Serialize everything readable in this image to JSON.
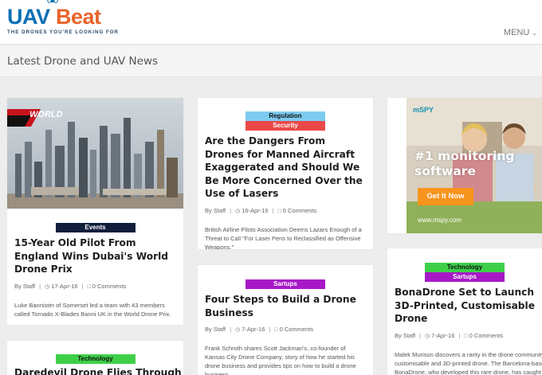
{
  "header": {
    "logo_uav": "UAV",
    "logo_beat": "Beat",
    "tagline": "THE DRONES YOU'RE LOOKING FOR",
    "menu_label": "MENU",
    "menu_icon": "chevron-down-icon"
  },
  "subheader": {
    "title": "Latest Drone and UAV News"
  },
  "articles": [
    {
      "badges": [
        "Events"
      ],
      "title": "15-Year Old Pilot From England Wins Dubai's World Drone Prix",
      "author": "By Staff",
      "date": "17-Apr-16",
      "comments": "0 Comments",
      "excerpt": "Luke Bannister of Somerset led a team with 43 members called Tornado X-Blades Banni UK in the World Drone Prix.",
      "image_text": "WORLD"
    },
    {
      "badges": [
        "Regulation",
        "Security"
      ],
      "title": "Are the Dangers From Drones for Manned Aircraft Exaggerated and Should We Be More Concerned Over the Use of Lasers",
      "author": "By Staff",
      "date": "16-Apr-16",
      "comments": "0 Comments",
      "excerpt": "British Airline Pilots Association Deems Lazars Enough of a Threat to Call \"For Laser Pens to Reclassified as Offensive Weapons.\""
    },
    {
      "badges": [
        "Sartups"
      ],
      "title": "Four Steps to Build a Drone Business",
      "author": "By Staff",
      "date": "7-Apr-16",
      "comments": "0 Comments",
      "excerpt": "Frank Schroth shares Scott Jackman's, co-founder of Kansas City Drone Company, story of how he started his drone business and provides tips on how to build a drone business."
    },
    {
      "badges": [
        "Technology",
        "Sartups"
      ],
      "title": "BonaDrone Set to Launch 3D-Printed, Customisable Drone",
      "author": "By Staff",
      "date": "7-Apr-16",
      "comments": "0 Comments",
      "excerpt": "Malek Murison discovers a rarity in the drone community. A customisable and 3D-printed drone. The Barcelona-based BonaDrone, who developed this rare drone, has caught the attention of drone enthusiasts. BonaDrone"
    },
    {
      "badges": [
        "Technology"
      ],
      "title": "Daredevil Drone Flies Through the"
    }
  ],
  "ad": {
    "brand": "mSPY",
    "headline_1": "#1 monitoring",
    "headline_2": "software",
    "cta": "Get It Now",
    "url": "www.mspy.com"
  },
  "icons": {
    "author": "person-icon",
    "date": "calendar-icon",
    "comments": "comment-icon"
  },
  "colors": {
    "logo_blue": "#0a6fb5",
    "logo_orange": "#e8632a",
    "events": "#101e3c",
    "regulation": "#7ecbf0",
    "security": "#ea4848",
    "startups": "#a719c7",
    "technology": "#3ecf49",
    "ad_cta": "#f7941d"
  }
}
